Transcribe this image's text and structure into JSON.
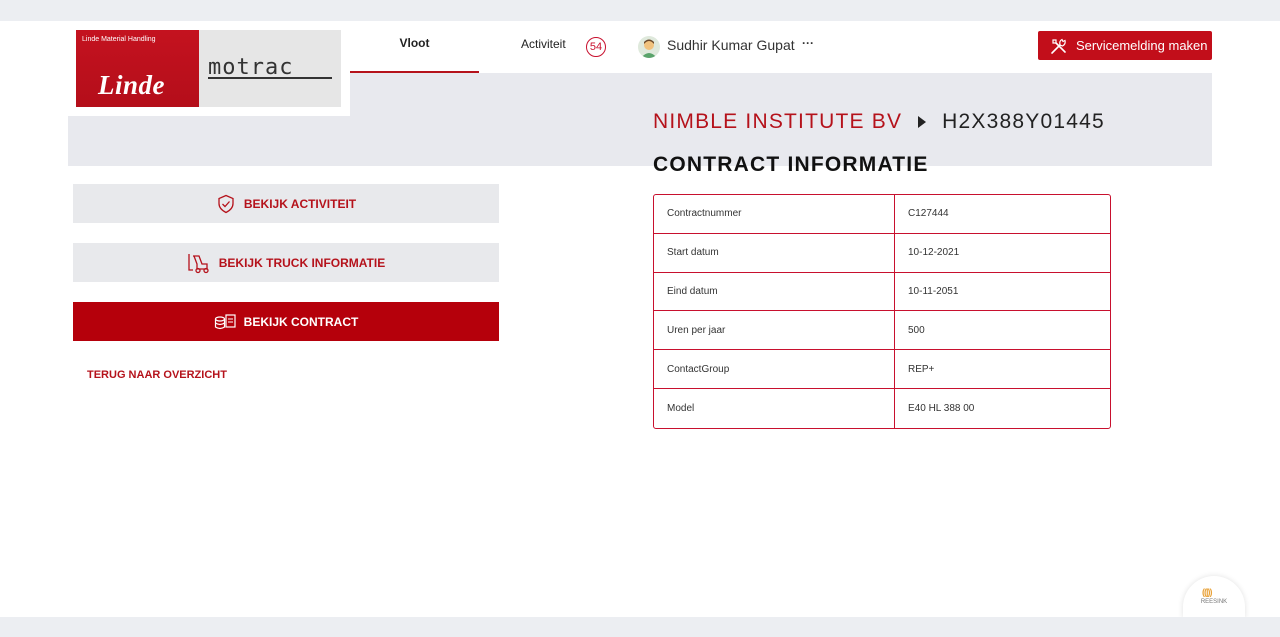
{
  "header": {
    "brand_small": "Linde Material Handling",
    "brand_linde": "Linde",
    "brand_motrac": "motrac",
    "nav": {
      "vloot": "Vloot",
      "activiteit": "Activiteit",
      "activiteit_count": "54"
    },
    "user": {
      "name": "Sudhir Kumar Gupat",
      "more": "···"
    },
    "service_button": "Servicemelding maken"
  },
  "sidebar": {
    "buttons": [
      {
        "label": "BEKIJK ACTIVITEIT",
        "icon": "shield-check-icon"
      },
      {
        "label": "BEKIJK TRUCK INFORMATIE",
        "icon": "forklift-icon"
      },
      {
        "label": "BEKIJK CONTRACT",
        "icon": "contract-icon"
      }
    ],
    "back_link": "TERUG NAAR OVERZICHT"
  },
  "main": {
    "breadcrumb": {
      "organization": "NIMBLE INSTITUTE BV",
      "serial": "H2X388Y01445"
    },
    "title": "CONTRACT INFORMATIE",
    "rows": [
      {
        "key": "Contractnummer",
        "value": "C127444"
      },
      {
        "key": "Start datum",
        "value": "10-12-2021"
      },
      {
        "key": "Eind datum",
        "value": "10-11-2051"
      },
      {
        "key": "Uren per jaar",
        "value": "500"
      },
      {
        "key": "ContactGroup",
        "value": "REP+"
      },
      {
        "key": "Model",
        "value": "E40 HL 388 00"
      }
    ]
  },
  "footer": {
    "reesink_label": "REESINK"
  },
  "colors": {
    "accent": "#b5121b",
    "active_button": "#b5000b",
    "band": "#e8e9ee"
  }
}
